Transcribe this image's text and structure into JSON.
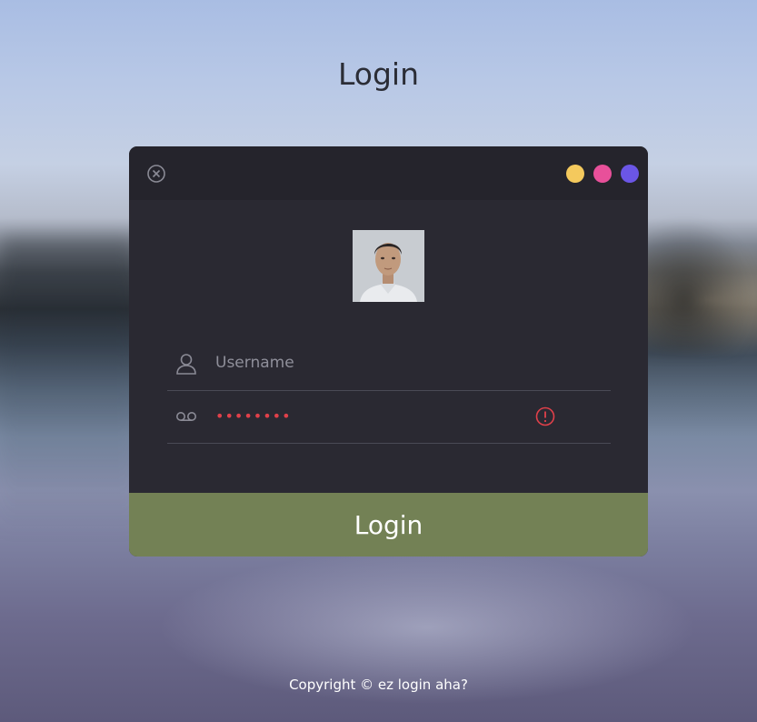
{
  "page": {
    "title": "Login",
    "copyright": "Copyright © ez login aha?"
  },
  "window": {
    "close_icon": "close-circle-icon",
    "dots": [
      {
        "name": "yellow-dot",
        "color": "#f4c95d"
      },
      {
        "name": "pink-dot",
        "color": "#e8509a"
      },
      {
        "name": "purple-dot",
        "color": "#6b56e6"
      }
    ]
  },
  "form": {
    "username": {
      "icon": "user-icon",
      "placeholder": "Username",
      "value": ""
    },
    "password": {
      "icon": "voicemail-icon",
      "value": "••••••••",
      "status_icon": "warning-circle-icon",
      "status_color": "#e0404a"
    },
    "submit_label": "Login"
  },
  "colors": {
    "card_bg": "#2a2932",
    "header_bg": "#25242c",
    "button_bg": "#738155"
  }
}
